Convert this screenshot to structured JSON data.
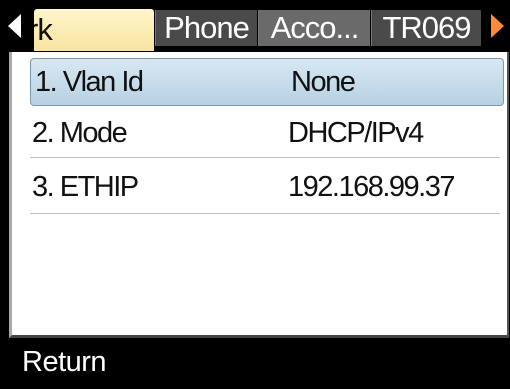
{
  "tabs": [
    {
      "label": "rk",
      "active": true
    },
    {
      "label": "Phone",
      "active": false
    },
    {
      "label": "Acco...",
      "active": false
    },
    {
      "label": "TR069",
      "active": false
    }
  ],
  "rows": [
    {
      "label": "1. Vlan Id",
      "value": "None",
      "selected": true
    },
    {
      "label": "2. Mode",
      "value": "DHCP/IPv4",
      "selected": false
    },
    {
      "label": "3. ETHIP",
      "value": "192.168.99.37",
      "selected": false
    }
  ],
  "softkeys": {
    "return_label": "Return"
  },
  "icons": {
    "left": "arrow-left-icon",
    "right": "arrow-right-icon"
  },
  "colors": {
    "active_tab": "#f6e4a0",
    "selection": "#b6d1e3",
    "right_arrow": "#ff8a3a"
  }
}
